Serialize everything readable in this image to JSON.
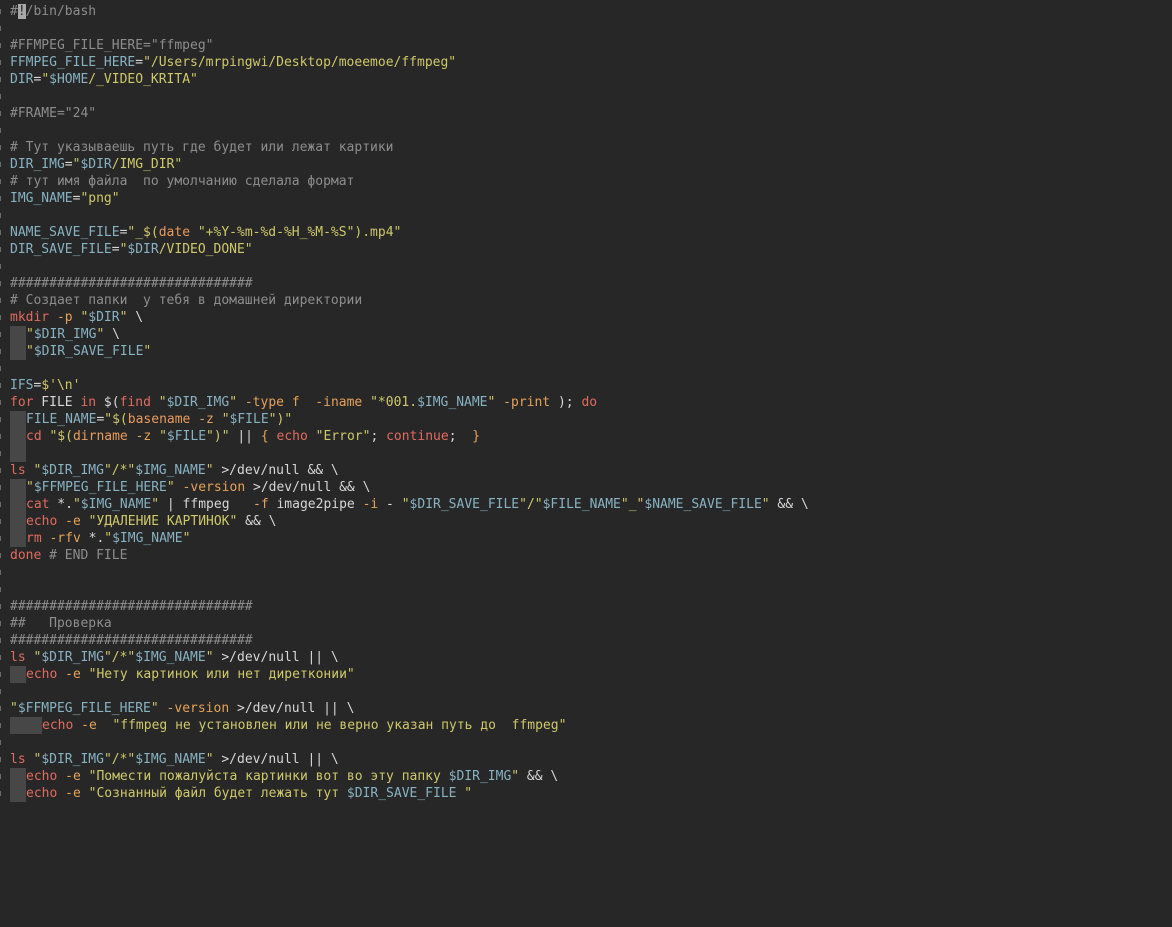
{
  "editor": {
    "language": "bash",
    "colors": {
      "background": "#272727",
      "comment": "#8d8d8d",
      "variable": "#87b2c3",
      "string": "#cfc86a",
      "keyword": "#e16b5f",
      "option": "#e6a158",
      "default": "#d7d7d7"
    },
    "lines": [
      {
        "i": 0,
        "t": [
          [
            "c",
            "#"
          ],
          [
            "cur",
            "!"
          ],
          [
            "c",
            "/bin/bash"
          ]
        ]
      },
      {
        "i": 0,
        "t": []
      },
      {
        "i": 0,
        "t": [
          [
            "c",
            "#FFMPEG_FILE_HERE=\"ffmpeg\""
          ]
        ]
      },
      {
        "i": 0,
        "t": [
          [
            "v",
            "FFMPEG_FILE_HERE"
          ],
          [
            "d",
            "="
          ],
          [
            "s",
            "\"/Users/mrpingwi/Desktop/moeemoe/ffmpeg\""
          ]
        ]
      },
      {
        "i": 0,
        "t": [
          [
            "v",
            "DIR"
          ],
          [
            "d",
            "="
          ],
          [
            "s",
            "\""
          ],
          [
            "v",
            "$HOME"
          ],
          [
            "s",
            "/_VIDEO_KRITA\""
          ]
        ]
      },
      {
        "i": 0,
        "t": []
      },
      {
        "i": 0,
        "t": [
          [
            "c",
            "#FRAME=\"24\""
          ]
        ]
      },
      {
        "i": 0,
        "t": []
      },
      {
        "i": 0,
        "t": [
          [
            "c",
            "# Тут указываешь путь где будет или лежат картики"
          ]
        ]
      },
      {
        "i": 0,
        "t": [
          [
            "v",
            "DIR_IMG"
          ],
          [
            "d",
            "="
          ],
          [
            "s",
            "\""
          ],
          [
            "v",
            "$DIR"
          ],
          [
            "s",
            "/IMG_DIR\""
          ]
        ]
      },
      {
        "i": 0,
        "t": [
          [
            "c",
            "# тут имя файла  по умолчанию сделала формат"
          ]
        ]
      },
      {
        "i": 0,
        "t": [
          [
            "v",
            "IMG_NAME"
          ],
          [
            "d",
            "="
          ],
          [
            "s",
            "\"png\""
          ]
        ]
      },
      {
        "i": 0,
        "t": []
      },
      {
        "i": 0,
        "t": [
          [
            "v",
            "NAME_SAVE_FILE"
          ],
          [
            "d",
            "="
          ],
          [
            "s",
            "\"_$("
          ],
          [
            "e",
            "date"
          ],
          [
            "s",
            " \"+%Y-%m-%d-%H_%M-%S\").mp4\""
          ]
        ]
      },
      {
        "i": 0,
        "t": [
          [
            "v",
            "DIR_SAVE_FILE"
          ],
          [
            "d",
            "="
          ],
          [
            "s",
            "\""
          ],
          [
            "v",
            "$DIR"
          ],
          [
            "s",
            "/VIDEO_DONE\""
          ]
        ]
      },
      {
        "i": 0,
        "t": []
      },
      {
        "i": 0,
        "t": [
          [
            "c",
            "###############################"
          ]
        ]
      },
      {
        "i": 0,
        "t": [
          [
            "c",
            "# Создает папки  у тебя в домашней директории"
          ]
        ]
      },
      {
        "i": 0,
        "t": [
          [
            "k",
            "mkdir"
          ],
          [
            "d",
            " "
          ],
          [
            "o",
            "-p"
          ],
          [
            "d",
            " "
          ],
          [
            "s",
            "\""
          ],
          [
            "v",
            "$DIR"
          ],
          [
            "s",
            "\""
          ],
          [
            "d",
            " \\"
          ]
        ]
      },
      {
        "i": 1,
        "t": [
          [
            "s",
            "\""
          ],
          [
            "v",
            "$DIR_IMG"
          ],
          [
            "s",
            "\""
          ],
          [
            "d",
            " \\"
          ]
        ]
      },
      {
        "i": 1,
        "t": [
          [
            "s",
            "\""
          ],
          [
            "v",
            "$DIR_SAVE_FILE"
          ],
          [
            "s",
            "\""
          ]
        ]
      },
      {
        "i": 0,
        "t": []
      },
      {
        "i": 0,
        "t": [
          [
            "v",
            "IFS"
          ],
          [
            "d",
            "="
          ],
          [
            "s",
            "$'\\n'"
          ]
        ]
      },
      {
        "i": 0,
        "t": [
          [
            "k",
            "for"
          ],
          [
            "d",
            " FILE "
          ],
          [
            "k",
            "in"
          ],
          [
            "d",
            " $("
          ],
          [
            "k",
            "find"
          ],
          [
            "d",
            " "
          ],
          [
            "s",
            "\""
          ],
          [
            "v",
            "$DIR_IMG"
          ],
          [
            "s",
            "\""
          ],
          [
            "d",
            " "
          ],
          [
            "o",
            "-type"
          ],
          [
            "d",
            " "
          ],
          [
            "o",
            "f"
          ],
          [
            "d",
            "  "
          ],
          [
            "o",
            "-iname"
          ],
          [
            "d",
            " "
          ],
          [
            "s",
            "\"*001."
          ],
          [
            "v",
            "$IMG_NAME"
          ],
          [
            "s",
            "\""
          ],
          [
            "d",
            " "
          ],
          [
            "o",
            "-print"
          ],
          [
            "d",
            " ); "
          ],
          [
            "k",
            "do"
          ]
        ]
      },
      {
        "i": 1,
        "t": [
          [
            "v",
            "FILE_NAME"
          ],
          [
            "d",
            "="
          ],
          [
            "s",
            "\"$("
          ],
          [
            "e",
            "basename"
          ],
          [
            "d",
            " "
          ],
          [
            "o",
            "-z"
          ],
          [
            "d",
            " "
          ],
          [
            "s",
            "\""
          ],
          [
            "v",
            "$FILE"
          ],
          [
            "s",
            "\")\""
          ]
        ]
      },
      {
        "i": 1,
        "t": [
          [
            "k",
            "cd"
          ],
          [
            "d",
            " "
          ],
          [
            "s",
            "\"$("
          ],
          [
            "e",
            "dirname"
          ],
          [
            "d",
            " "
          ],
          [
            "o",
            "-z"
          ],
          [
            "d",
            " "
          ],
          [
            "s",
            "\""
          ],
          [
            "v",
            "$FILE"
          ],
          [
            "s",
            "\")\""
          ],
          [
            "d",
            " || "
          ],
          [
            "o",
            "{"
          ],
          [
            "d",
            " "
          ],
          [
            "k",
            "echo"
          ],
          [
            "d",
            " "
          ],
          [
            "s",
            "\"Error\""
          ],
          [
            "d",
            "; "
          ],
          [
            "k",
            "continue"
          ],
          [
            "d",
            ";  "
          ],
          [
            "o",
            "}"
          ]
        ]
      },
      {
        "i": 1,
        "t": []
      },
      {
        "i": 0,
        "t": [
          [
            "k",
            "ls"
          ],
          [
            "d",
            " "
          ],
          [
            "s",
            "\""
          ],
          [
            "v",
            "$DIR_IMG"
          ],
          [
            "s",
            "\"/*\""
          ],
          [
            "v",
            "$IMG_NAME"
          ],
          [
            "s",
            "\""
          ],
          [
            "d",
            " >/dev/null && \\"
          ]
        ]
      },
      {
        "i": 1,
        "t": [
          [
            "s",
            "\""
          ],
          [
            "v",
            "$FFMPEG_FILE_HERE"
          ],
          [
            "s",
            "\""
          ],
          [
            "d",
            " "
          ],
          [
            "o",
            "-version"
          ],
          [
            "d",
            " >/dev/null && \\"
          ]
        ]
      },
      {
        "i": 1,
        "t": [
          [
            "k",
            "cat"
          ],
          [
            "d",
            " *."
          ],
          [
            "s",
            "\""
          ],
          [
            "v",
            "$IMG_NAME"
          ],
          [
            "s",
            "\""
          ],
          [
            "d",
            " | ffmpeg   "
          ],
          [
            "o",
            "-f"
          ],
          [
            "d",
            " image2pipe "
          ],
          [
            "o",
            "-i"
          ],
          [
            "d",
            " - "
          ],
          [
            "s",
            "\""
          ],
          [
            "v",
            "$DIR_SAVE_FILE"
          ],
          [
            "s",
            "\"/\""
          ],
          [
            "v",
            "$FILE_NAME"
          ],
          [
            "s",
            "\"_\""
          ],
          [
            "v",
            "$NAME_SAVE_FILE"
          ],
          [
            "s",
            "\""
          ],
          [
            "d",
            " && \\"
          ]
        ]
      },
      {
        "i": 1,
        "t": [
          [
            "k",
            "echo"
          ],
          [
            "d",
            " "
          ],
          [
            "o",
            "-e"
          ],
          [
            "d",
            " "
          ],
          [
            "s",
            "\"УДАЛЕНИЕ КАРТИНОК\""
          ],
          [
            "d",
            " && \\"
          ]
        ]
      },
      {
        "i": 1,
        "t": [
          [
            "k",
            "rm"
          ],
          [
            "d",
            " "
          ],
          [
            "o",
            "-rfv"
          ],
          [
            "d",
            " *."
          ],
          [
            "s",
            "\""
          ],
          [
            "v",
            "$IMG_NAME"
          ],
          [
            "s",
            "\""
          ]
        ]
      },
      {
        "i": 0,
        "t": [
          [
            "k",
            "done"
          ],
          [
            "d",
            " "
          ],
          [
            "c",
            "# END FILE"
          ]
        ]
      },
      {
        "i": 0,
        "t": []
      },
      {
        "i": 0,
        "t": []
      },
      {
        "i": 0,
        "t": [
          [
            "c",
            "###############################"
          ]
        ]
      },
      {
        "i": 0,
        "t": [
          [
            "c",
            "##   Проверка"
          ]
        ]
      },
      {
        "i": 0,
        "t": [
          [
            "c",
            "###############################"
          ]
        ]
      },
      {
        "i": 0,
        "t": [
          [
            "k",
            "ls"
          ],
          [
            "d",
            " "
          ],
          [
            "s",
            "\""
          ],
          [
            "v",
            "$DIR_IMG"
          ],
          [
            "s",
            "\"/*\""
          ],
          [
            "v",
            "$IMG_NAME"
          ],
          [
            "s",
            "\""
          ],
          [
            "d",
            " >/dev/null || \\"
          ]
        ]
      },
      {
        "i": 1,
        "t": [
          [
            "k",
            "echo"
          ],
          [
            "d",
            " "
          ],
          [
            "o",
            "-e"
          ],
          [
            "d",
            " "
          ],
          [
            "s",
            "\"Нету картинок или нет диретконии\""
          ]
        ]
      },
      {
        "i": 0,
        "t": []
      },
      {
        "i": 0,
        "t": [
          [
            "s",
            "\""
          ],
          [
            "v",
            "$FFMPEG_FILE_HERE"
          ],
          [
            "s",
            "\""
          ],
          [
            "d",
            " "
          ],
          [
            "o",
            "-version"
          ],
          [
            "d",
            " >/dev/null || \\"
          ]
        ]
      },
      {
        "i": 2,
        "t": [
          [
            "k",
            "echo"
          ],
          [
            "d",
            " "
          ],
          [
            "o",
            "-e"
          ],
          [
            "d",
            "  "
          ],
          [
            "s",
            "\"ffmpeg не установлен или не верно указан путь до  ffmpeg\""
          ]
        ]
      },
      {
        "i": 0,
        "t": []
      },
      {
        "i": 0,
        "t": [
          [
            "k",
            "ls"
          ],
          [
            "d",
            " "
          ],
          [
            "s",
            "\""
          ],
          [
            "v",
            "$DIR_IMG"
          ],
          [
            "s",
            "\"/*\""
          ],
          [
            "v",
            "$IMG_NAME"
          ],
          [
            "s",
            "\""
          ],
          [
            "d",
            " >/dev/null || \\"
          ]
        ]
      },
      {
        "i": 1,
        "t": [
          [
            "k",
            "echo"
          ],
          [
            "d",
            " "
          ],
          [
            "o",
            "-e"
          ],
          [
            "d",
            " "
          ],
          [
            "s",
            "\"Помести пожалуйста картинки вот во эту папку "
          ],
          [
            "v",
            "$DIR_IMG"
          ],
          [
            "s",
            "\""
          ],
          [
            "d",
            " && \\"
          ]
        ]
      },
      {
        "i": 1,
        "t": [
          [
            "k",
            "echo"
          ],
          [
            "d",
            " "
          ],
          [
            "o",
            "-e"
          ],
          [
            "d",
            " "
          ],
          [
            "s",
            "\"Сознанный файл будет лежать тут "
          ],
          [
            "v",
            "$DIR_SAVE_FILE"
          ],
          [
            "s",
            " \""
          ]
        ]
      }
    ]
  }
}
